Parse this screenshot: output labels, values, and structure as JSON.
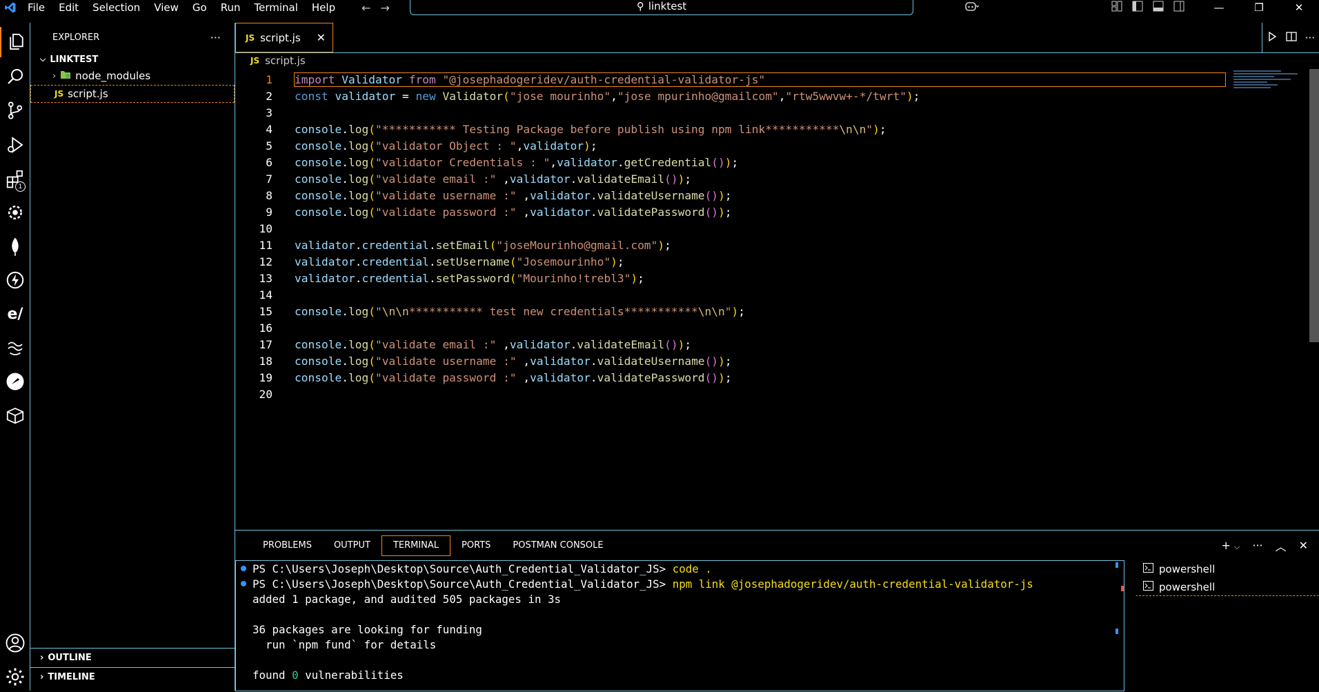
{
  "menu": [
    "File",
    "Edit",
    "Selection",
    "View",
    "Go",
    "Run",
    "Terminal",
    "Help"
  ],
  "search": {
    "text": "linktest"
  },
  "explorer": {
    "title": "EXPLORER",
    "more": "···",
    "root": "LINKTEST",
    "items": [
      {
        "label": "node_modules"
      },
      {
        "label": "script.js",
        "badge": "JS"
      }
    ],
    "outline": "OUTLINE",
    "timeline": "TIMELINE"
  },
  "activity": {
    "extensions_badge": "1"
  },
  "editor": {
    "tab": {
      "label": "script.js",
      "badge": "JS",
      "close": "✕"
    },
    "breadcrumb": {
      "label": "script.js",
      "badge": "JS"
    },
    "line_numbers": [
      "1",
      "2",
      "3",
      "4",
      "5",
      "6",
      "7",
      "8",
      "9",
      "10",
      "11",
      "12",
      "13",
      "14",
      "15",
      "16",
      "17",
      "18",
      "19",
      "20"
    ]
  },
  "panel": {
    "tabs": [
      "PROBLEMS",
      "OUTPUT",
      "TERMINAL",
      "PORTS",
      "POSTMAN CONSOLE"
    ],
    "active_tab": "TERMINAL",
    "prompt1": "PS C:\\Users\\Joseph\\Desktop\\Source\\Auth_Credential_Validator_JS> ",
    "cmd1": "code .",
    "prompt2": "PS C:\\Users\\Joseph\\Desktop\\Source\\Auth_Credential_Validator_JS> ",
    "cmd2": "npm link @josephadogeridev/auth-credential-validator-js",
    "out1": "added 1 package, and audited 505 packages in 3s",
    "out2": "36 packages are looking for funding",
    "out3": "  run `npm fund` for details",
    "out4_a": "found ",
    "out4_b": "0",
    "out4_c": " vulnerabilities",
    "terminals": [
      "powershell",
      "powershell"
    ]
  },
  "colors": {
    "accent": "#f38518",
    "border": "#6fc3df",
    "string": "#ce9178",
    "keyword": "#569cd6"
  }
}
